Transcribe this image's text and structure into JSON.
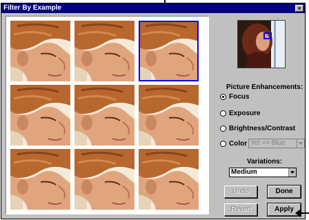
{
  "window": {
    "title": "Filter By Example",
    "close_glyph": "×"
  },
  "grid": {
    "selected_index": 2,
    "tile_count": 9
  },
  "enhancements": {
    "heading": "Picture Enhancements:",
    "options": [
      {
        "label": "Focus",
        "checked": true
      },
      {
        "label": "Exposure",
        "checked": false
      },
      {
        "label": "Brightness/Contrast",
        "checked": false
      },
      {
        "label": "Color",
        "checked": false
      }
    ],
    "color_select": {
      "value": "Yel => Blue",
      "enabled": false
    }
  },
  "variations": {
    "label": "Variations:",
    "value": "Medium"
  },
  "buttons": {
    "undo": {
      "label": "Undo",
      "enabled": false
    },
    "done": {
      "label": "Done",
      "enabled": true
    },
    "revert": {
      "label": "Revert",
      "enabled": false
    },
    "apply": {
      "label": "Apply",
      "enabled": true
    }
  },
  "colors": {
    "title_bar": "#000080",
    "selection": "#0000ff",
    "face": "#c0c0c0"
  }
}
